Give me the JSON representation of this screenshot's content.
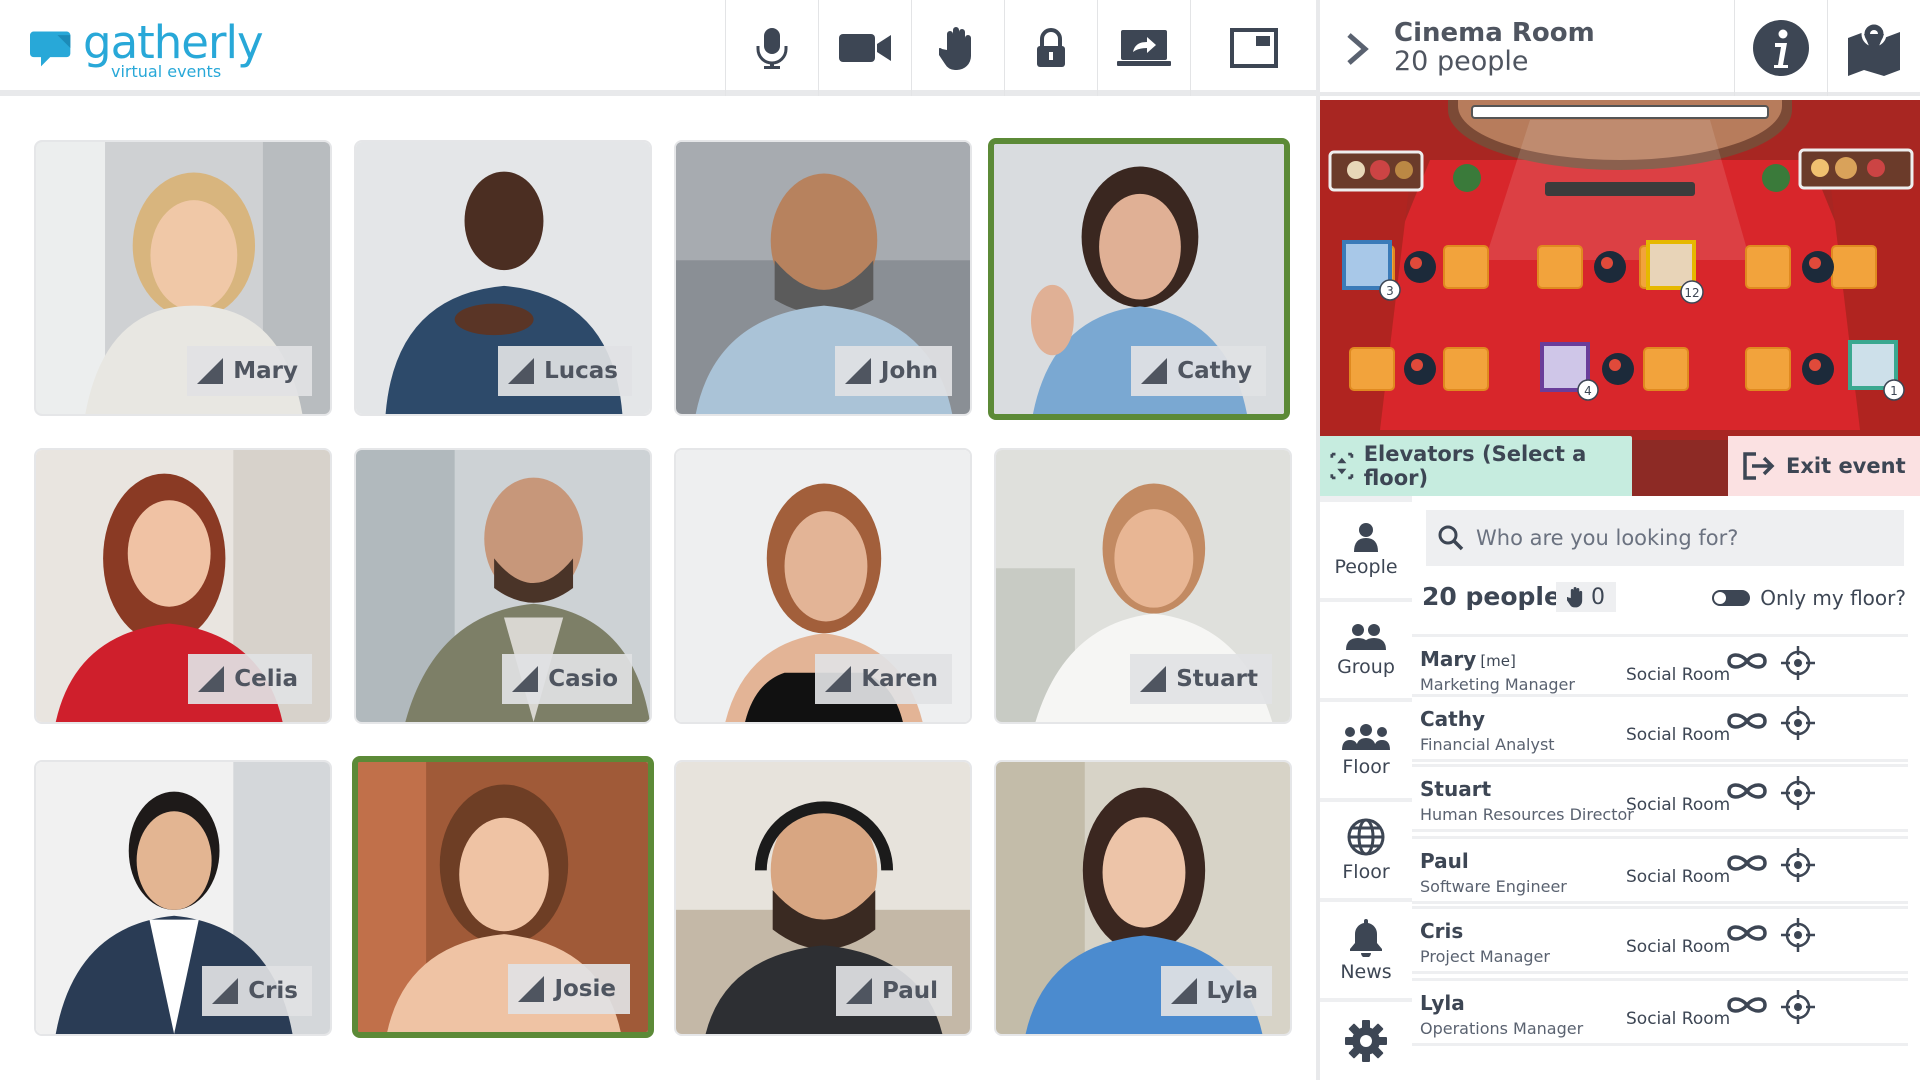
{
  "brand": {
    "name": "gatherly",
    "tagline": "virtual events",
    "accent": "#28a8d8"
  },
  "toolbar": {
    "buttons": [
      {
        "name": "microphone-button",
        "icon": "microphone-icon"
      },
      {
        "name": "camera-button",
        "icon": "video-camera-icon"
      },
      {
        "name": "raise-hand-button",
        "icon": "hand-icon"
      },
      {
        "name": "lock-button",
        "icon": "lock-icon"
      },
      {
        "name": "share-screen-button",
        "icon": "share-screen-icon"
      },
      {
        "name": "layout-button",
        "icon": "window-layout-icon"
      }
    ]
  },
  "video_tiles": [
    {
      "name": "Mary",
      "active": false
    },
    {
      "name": "Lucas",
      "active": false
    },
    {
      "name": "John",
      "active": false
    },
    {
      "name": "Cathy",
      "active": true
    },
    {
      "name": "Celia",
      "active": false
    },
    {
      "name": "Casio",
      "active": false
    },
    {
      "name": "Karen",
      "active": false
    },
    {
      "name": "Stuart",
      "active": false
    },
    {
      "name": "Cris",
      "active": false
    },
    {
      "name": "Josie",
      "active": true
    },
    {
      "name": "Paul",
      "active": false
    },
    {
      "name": "Lyla",
      "active": false
    }
  ],
  "room_header": {
    "room_name": "Cinema Room",
    "people_count": "20 people"
  },
  "map": {
    "badges": [
      "3",
      "12",
      "4",
      "1"
    ]
  },
  "actions": {
    "elevators_label": "Elevators (Select a floor)",
    "exit_label": "Exit event"
  },
  "sidenav": [
    {
      "label": "People",
      "icon": "person-icon"
    },
    {
      "label": "Group",
      "icon": "group-icon"
    },
    {
      "label": "Floor",
      "icon": "people-floor-icon"
    },
    {
      "label": "Floor",
      "icon": "globe-icon"
    },
    {
      "label": "News",
      "icon": "bell-icon"
    },
    {
      "label": "",
      "icon": "gear-icon"
    }
  ],
  "people_panel": {
    "search_placeholder": "Who are you looking for?",
    "count_label": "20 people",
    "raised_hands": "0",
    "toggle_label": "Only my floor?",
    "me_tag": "[me]",
    "people": [
      {
        "name": "Mary",
        "me": true,
        "role": "Marketing Manager",
        "room": "Social Room"
      },
      {
        "name": "Cathy",
        "me": false,
        "role": "Financial Analyst",
        "room": "Social Room"
      },
      {
        "name": "Stuart",
        "me": false,
        "role": "Human Resources Director",
        "room": "Social Room"
      },
      {
        "name": "Paul",
        "me": false,
        "role": "Software Engineer",
        "room": "Social Room"
      },
      {
        "name": "Cris",
        "me": false,
        "role": "Project Manager",
        "room": "Social Room"
      },
      {
        "name": "Lyla",
        "me": false,
        "role": "Operations Manager",
        "room": "Social Room"
      }
    ]
  },
  "colors": {
    "active_border": "#5c8a37",
    "elevator_bg": "#c6ecdf",
    "exit_bg": "#fbe1e2",
    "carpet": "#d8262b"
  }
}
